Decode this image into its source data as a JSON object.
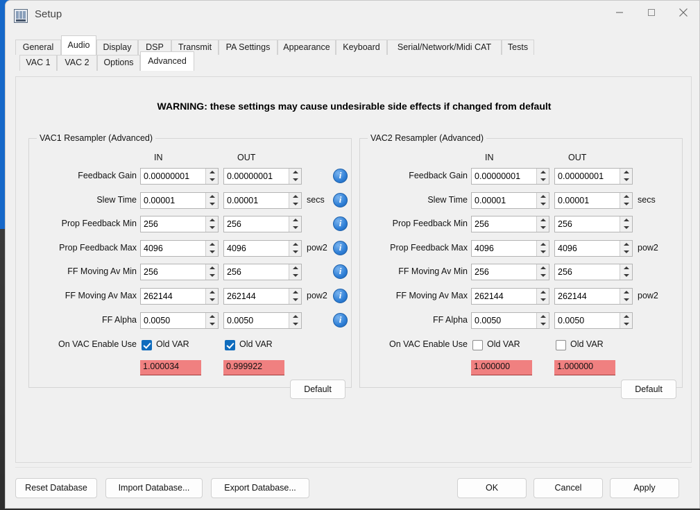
{
  "window": {
    "title": "Setup",
    "icon": "app-window-icon",
    "controls": {
      "minimize": "minimize-icon",
      "maximize": "maximize-icon",
      "close": "close-icon"
    }
  },
  "tabs_primary": [
    {
      "label": "General",
      "selected": false
    },
    {
      "label": "Audio",
      "selected": true
    },
    {
      "label": "Display",
      "selected": false
    },
    {
      "label": "DSP",
      "selected": false
    },
    {
      "label": "Transmit",
      "selected": false
    },
    {
      "label": "PA Settings",
      "selected": false
    },
    {
      "label": "Appearance",
      "selected": false
    },
    {
      "label": "Keyboard",
      "selected": false
    },
    {
      "label": "Serial/Network/Midi CAT",
      "selected": false
    },
    {
      "label": "Tests",
      "selected": false
    }
  ],
  "tabs_secondary": [
    {
      "label": "VAC 1",
      "selected": false
    },
    {
      "label": "VAC 2",
      "selected": false
    },
    {
      "label": "Options",
      "selected": false
    },
    {
      "label": "Advanced",
      "selected": true
    }
  ],
  "warning": "WARNING: these settings may cause undesirable side effects if changed from default",
  "column_headers": {
    "in": "IN",
    "out": "OUT"
  },
  "groups": [
    {
      "title": "VAC1 Resampler (Advanced)",
      "has_info_icons": true,
      "rows": [
        {
          "label": "Feedback Gain",
          "in": "0.00000001",
          "out": "0.00000001",
          "unit": ""
        },
        {
          "label": "Slew Time",
          "in": "0.00001",
          "out": "0.00001",
          "unit": "secs"
        },
        {
          "label": "Prop Feedback Min",
          "in": "256",
          "out": "256",
          "unit": ""
        },
        {
          "label": "Prop Feedback Max",
          "in": "4096",
          "out": "4096",
          "unit": "pow2"
        },
        {
          "label": "FF Moving Av Min",
          "in": "256",
          "out": "256",
          "unit": ""
        },
        {
          "label": "FF Moving Av Max",
          "in": "262144",
          "out": "262144",
          "unit": "pow2"
        },
        {
          "label": "FF Alpha",
          "in": "0.0050",
          "out": "0.0050",
          "unit": ""
        }
      ],
      "enable_row": {
        "label": "On VAC Enable Use",
        "in_checkbox": {
          "label": "Old VAR",
          "checked": true
        },
        "out_checkbox": {
          "label": "Old VAR",
          "checked": true
        }
      },
      "readouts": {
        "in": "1.000034",
        "out": "0.999922"
      },
      "default_button": "Default"
    },
    {
      "title": "VAC2 Resampler (Advanced)",
      "has_info_icons": false,
      "rows": [
        {
          "label": "Feedback Gain",
          "in": "0.00000001",
          "out": "0.00000001",
          "unit": ""
        },
        {
          "label": "Slew Time",
          "in": "0.00001",
          "out": "0.00001",
          "unit": "secs"
        },
        {
          "label": "Prop Feedback Min",
          "in": "256",
          "out": "256",
          "unit": ""
        },
        {
          "label": "Prop Feedback Max",
          "in": "4096",
          "out": "4096",
          "unit": "pow2"
        },
        {
          "label": "FF Moving Av Min",
          "in": "256",
          "out": "256",
          "unit": ""
        },
        {
          "label": "FF Moving Av Max",
          "in": "262144",
          "out": "262144",
          "unit": "pow2"
        },
        {
          "label": "FF Alpha",
          "in": "0.0050",
          "out": "0.0050",
          "unit": ""
        }
      ],
      "enable_row": {
        "label": "On VAC Enable Use",
        "in_checkbox": {
          "label": "Old VAR",
          "checked": false
        },
        "out_checkbox": {
          "label": "Old VAR",
          "checked": false
        }
      },
      "readouts": {
        "in": "1.000000",
        "out": "1.000000"
      },
      "default_button": "Default"
    }
  ],
  "footer": {
    "left_buttons": [
      "Reset Database",
      "Import Database...",
      "Export Database..."
    ],
    "right_buttons": [
      "OK",
      "Cancel",
      "Apply"
    ]
  },
  "colors": {
    "readout_bg": "#f08080",
    "checkbox_accent": "#0f6cbd",
    "info_icon": "#2f7fd6",
    "window_bg": "#f0f0f0"
  }
}
